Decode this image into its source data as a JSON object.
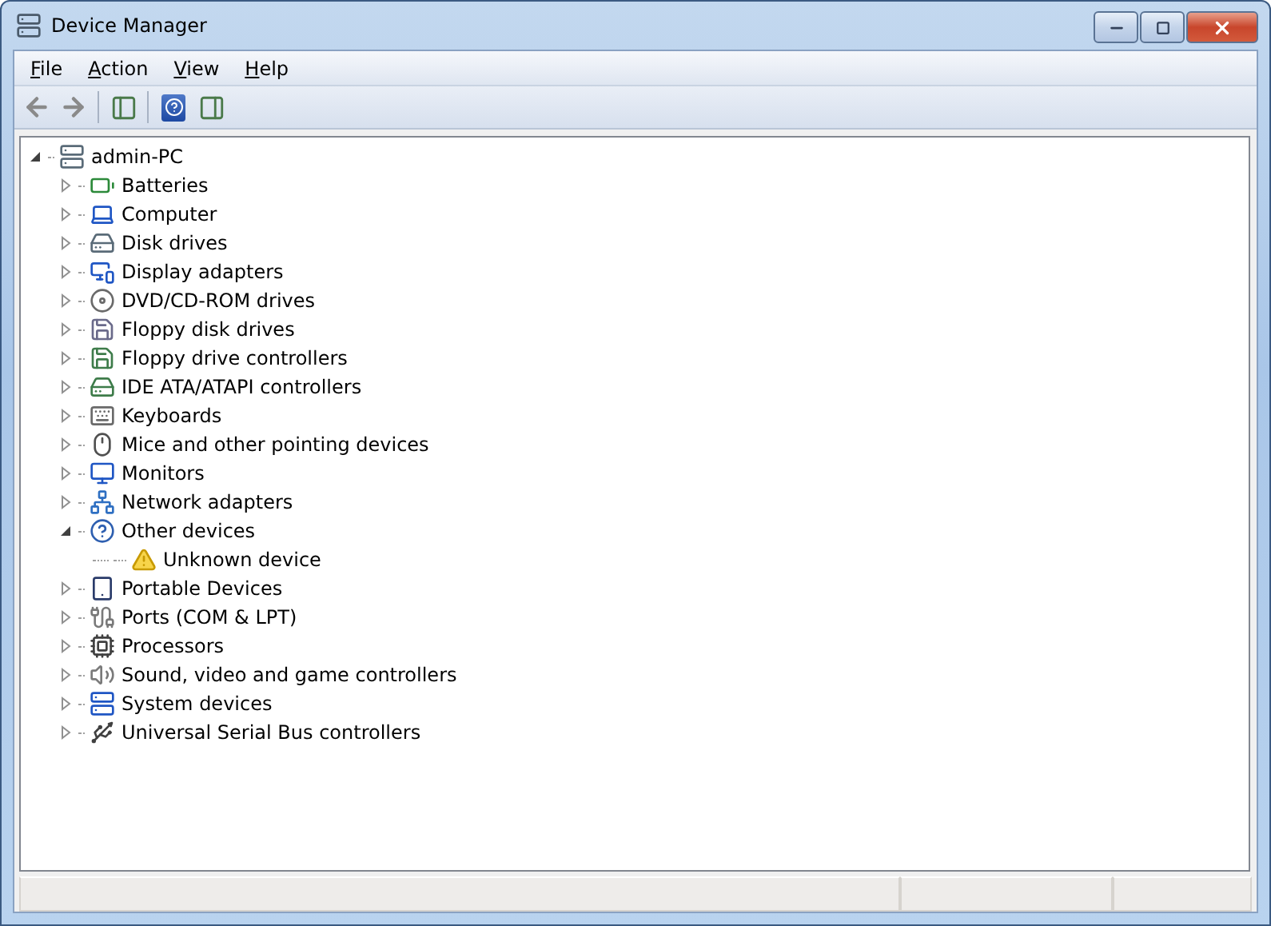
{
  "window": {
    "title": "Device Manager"
  },
  "menu": [
    "File",
    "Action",
    "View",
    "Help"
  ],
  "tree": [
    {
      "label": "admin-PC",
      "expanded": true,
      "children": [
        {
          "label": "Batteries",
          "expanded": false
        },
        {
          "label": "Computer",
          "expanded": false
        },
        {
          "label": "Disk drives",
          "expanded": false
        },
        {
          "label": "Display adapters",
          "expanded": false
        },
        {
          "label": "DVD/CD-ROM drives",
          "expanded": false
        },
        {
          "label": "Floppy disk drives",
          "expanded": false
        },
        {
          "label": "Floppy drive controllers",
          "expanded": false
        },
        {
          "label": "IDE ATA/ATAPI controllers",
          "expanded": false
        },
        {
          "label": "Keyboards",
          "expanded": false
        },
        {
          "label": "Mice and other pointing devices",
          "expanded": false
        },
        {
          "label": "Monitors",
          "expanded": false
        },
        {
          "label": "Network adapters",
          "expanded": false
        },
        {
          "label": "Other devices",
          "expanded": true,
          "children": [
            {
              "label": "Unknown device"
            }
          ]
        },
        {
          "label": "Portable Devices",
          "expanded": false
        },
        {
          "label": "Ports (COM & LPT)",
          "expanded": false
        },
        {
          "label": "Processors",
          "expanded": false
        },
        {
          "label": "Sound, video and game controllers",
          "expanded": false
        },
        {
          "label": "System devices",
          "expanded": false
        },
        {
          "label": "Universal Serial Bus controllers",
          "expanded": false
        }
      ]
    }
  ]
}
